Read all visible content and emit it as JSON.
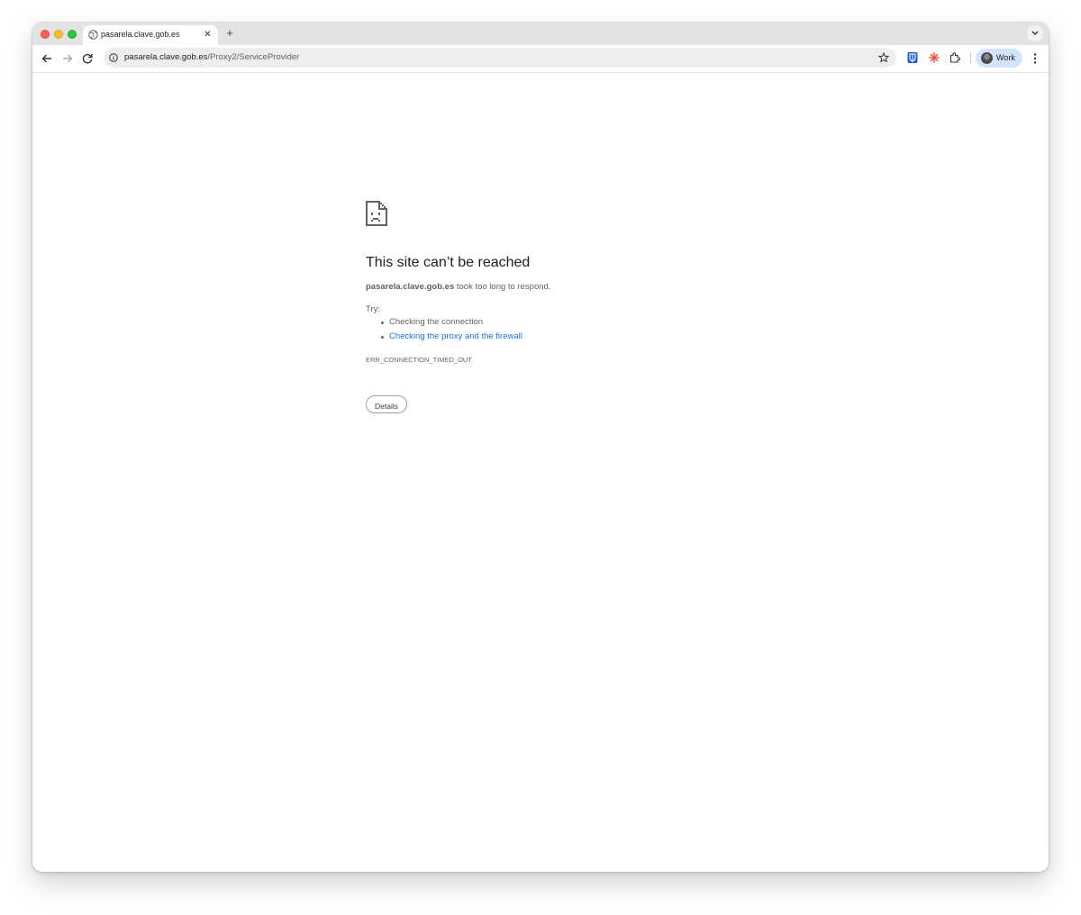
{
  "window": {
    "tab": {
      "title": "pasarela.clave.gob.es",
      "close_glyph": "✕",
      "icon": "globe-icon"
    },
    "new_tab_glyph": "+",
    "address_bar": {
      "host": "pasarela.clave.gob.es",
      "path": "/Proxy2/ServiceProvider"
    },
    "profile": {
      "label": "Work"
    },
    "extensions": [
      "bitwarden-icon",
      "sparkle-extension-icon",
      "puzzle-extensions-icon"
    ]
  },
  "error_page": {
    "icon": "sad-document-icon",
    "title": "This site can’t be reached",
    "host": "pasarela.clave.gob.es",
    "message_suffix": " took too long to respond.",
    "try_label": "Try:",
    "suggestions": [
      {
        "text": "Checking the connection",
        "is_link": false
      },
      {
        "text": "Checking the proxy and the firewall",
        "is_link": true
      }
    ],
    "error_code": "ERR_CONNECTION_TIMED_OUT",
    "details_button": "Details"
  },
  "colors": {
    "link": "#1a73e8",
    "profile_chip": "#d3e3fd",
    "tabstrip": "#e3e3e3",
    "omnibox": "#efeded"
  }
}
